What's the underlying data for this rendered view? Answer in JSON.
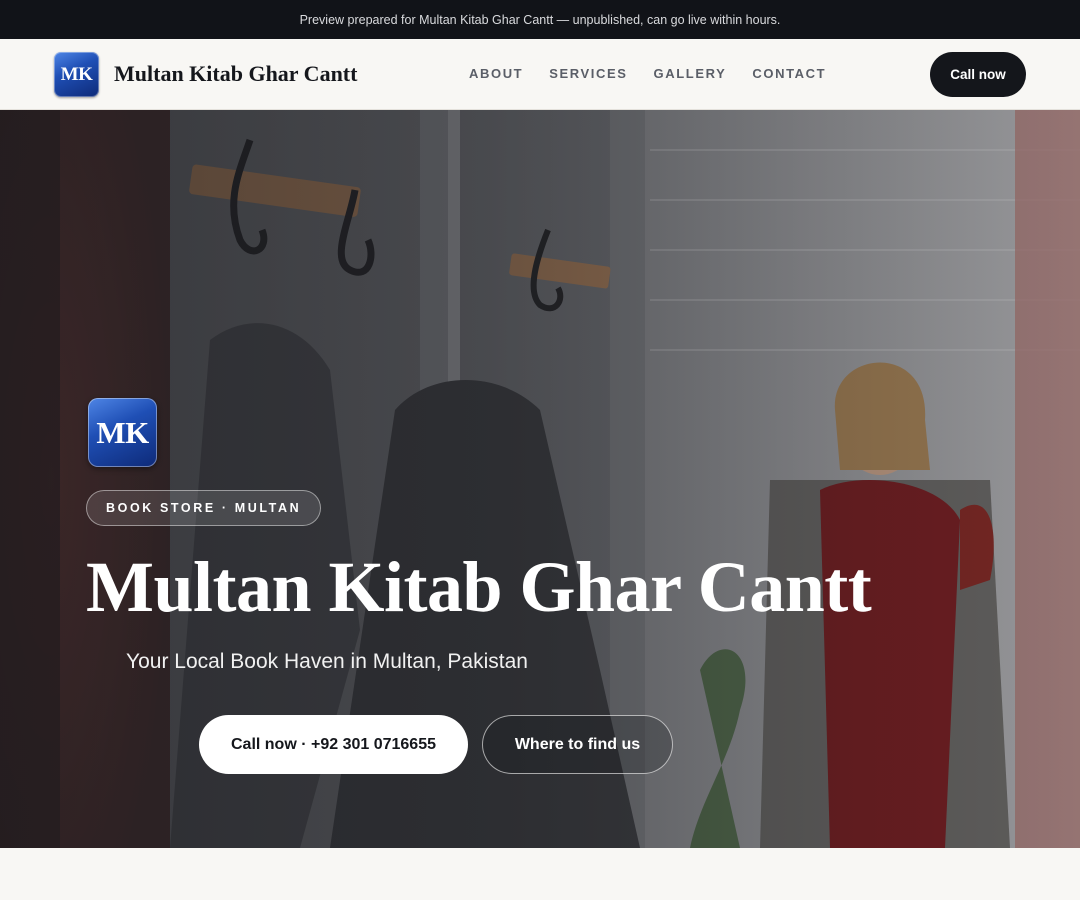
{
  "banner": {
    "text": "Preview prepared for Multan Kitab Ghar Cantt — unpublished, can go live within hours."
  },
  "header": {
    "logo_initials": "MK",
    "brand_name": "Multan Kitab Ghar Cantt",
    "nav": [
      "ABOUT",
      "SERVICES",
      "GALLERY",
      "CONTACT"
    ],
    "cta_label": "Call now"
  },
  "hero": {
    "logo_initials": "MK",
    "tag": "BOOK STORE · MULTAN",
    "title": "Multan Kitab Ghar Cantt",
    "subtitle": "Your Local Book Haven in Multan, Pakistan",
    "primary_button": "Call now · +92 301 0716655",
    "secondary_button": "Where to find us"
  },
  "colors": {
    "banner_bg": "#111318",
    "page_bg": "#f8f7f4",
    "dark": "#14161b",
    "logo_blue": "#1f4fb5"
  }
}
